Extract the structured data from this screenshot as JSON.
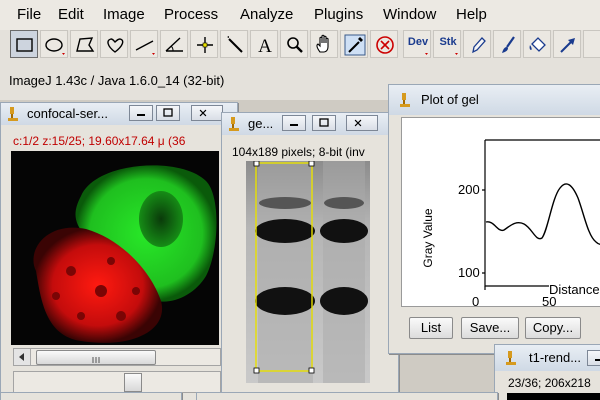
{
  "menubar": {
    "items": [
      "File",
      "Edit",
      "Image",
      "Process",
      "Analyze",
      "Plugins",
      "Window",
      "Help"
    ]
  },
  "toolbar": {
    "tools": [
      {
        "name": "rectangle-tool-icon"
      },
      {
        "name": "oval-tool-icon"
      },
      {
        "name": "polygon-tool-icon"
      },
      {
        "name": "freehand-tool-icon"
      },
      {
        "name": "line-tool-icon"
      },
      {
        "name": "angle-tool-icon"
      },
      {
        "name": "point-tool-icon"
      },
      {
        "name": "wand-tool-icon"
      },
      {
        "name": "text-tool-icon",
        "label": "A"
      },
      {
        "name": "magnifier-tool-icon"
      },
      {
        "name": "hand-tool-icon"
      },
      {
        "name": "color-picker-tool-icon"
      },
      {
        "name": "close-x-tool-icon"
      },
      {
        "name": "developer-menu-tool-icon",
        "label": "Dev"
      },
      {
        "name": "stack-tool-icon",
        "label": "Stk"
      },
      {
        "name": "pencil-tool-icon"
      },
      {
        "name": "brush-tool-icon"
      },
      {
        "name": "flood-fill-tool-icon"
      },
      {
        "name": "arrow-tool-icon"
      }
    ],
    "selected": "rectangle-tool-icon"
  },
  "status": "ImageJ 1.43c / Java 1.6.0_14 (32-bit)",
  "confocal_window": {
    "title": "confocal-ser...",
    "info": "c:1/2 z:15/25; 19.60x17.64 μ (36"
  },
  "gel_window": {
    "title": "ge...",
    "info": "104x189 pixels; 8-bit (inv"
  },
  "plot_window": {
    "title": "Plot of gel",
    "buttons": [
      "List",
      "Save...",
      "Copy..."
    ],
    "ylabel": "Gray Value",
    "xlabel": "Distance",
    "yticks": [
      "200",
      "100"
    ],
    "xticks": [
      "0",
      "50"
    ]
  },
  "t1_window": {
    "title": "t1-rend...",
    "info": "23/36; 206x218"
  },
  "colors": {
    "selection": "#e8e000",
    "roi_label": "#c00000",
    "green_channel": "#22e022",
    "red_channel": "#e01212"
  }
}
